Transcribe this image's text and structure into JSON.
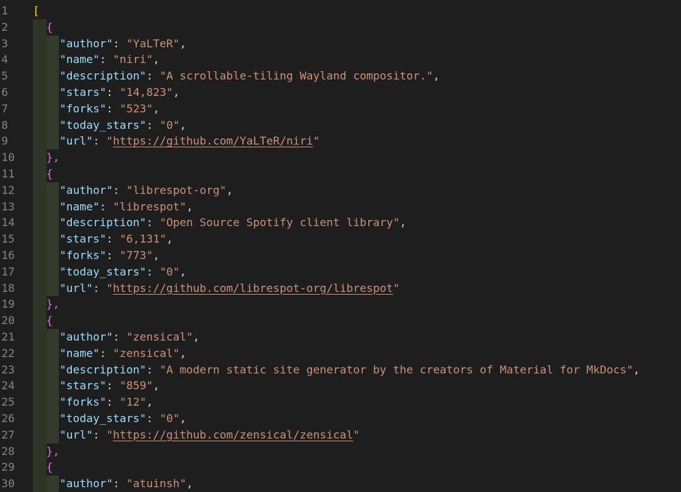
{
  "editor": {
    "top_partial_text": "",
    "line_numbers": [
      "1",
      "2",
      "3",
      "4",
      "5",
      "6",
      "7",
      "8",
      "9",
      "10",
      "11",
      "12",
      "13",
      "14",
      "15",
      "16",
      "17",
      "18",
      "19",
      "20",
      "21",
      "22",
      "23",
      "24",
      "25",
      "26",
      "27",
      "28",
      "29",
      "30"
    ],
    "open_array": "[",
    "open_obj": "{",
    "close_obj": "},",
    "repos": [
      {
        "author": "YaLTeR",
        "name": "niri",
        "description": "A scrollable-tiling Wayland compositor.",
        "stars": "14,823",
        "forks": "523",
        "today_stars": "0",
        "url": "https://github.com/YaLTeR/niri"
      },
      {
        "author": "librespot-org",
        "name": "librespot",
        "description": "Open Source Spotify client library",
        "stars": "6,131",
        "forks": "773",
        "today_stars": "0",
        "url": "https://github.com/librespot-org/librespot"
      },
      {
        "author": "zensical",
        "name": "zensical",
        "description": "A modern static site generator by the creators of Material for MkDocs",
        "stars": "859",
        "forks": "12",
        "today_stars": "0",
        "url": "https://github.com/zensical/zensical"
      },
      {
        "author": "atuinsh"
      }
    ],
    "keys": {
      "author": "\"author\"",
      "name": "\"name\"",
      "description": "\"description\"",
      "stars": "\"stars\"",
      "forks": "\"forks\"",
      "today_stars": "\"today_stars\"",
      "url": "\"url\""
    }
  },
  "colors": {
    "background": "#1e1e1e",
    "key": "#9cdcfe",
    "string": "#ce9178",
    "bracket_level1": "#ffd700",
    "bracket_level2": "#da70d6",
    "line_number": "#858585"
  }
}
